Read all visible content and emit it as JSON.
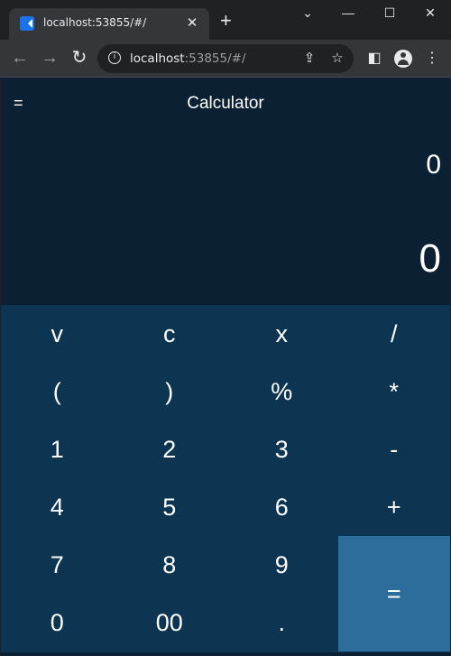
{
  "browser": {
    "tab_title": "localhost:53855/#/",
    "tab_close": "✕",
    "new_tab": "+",
    "window_controls": {
      "minimize": "—",
      "maximize": "☐",
      "close": "✕",
      "menu": "⌄"
    },
    "url_host": "localhost",
    "url_rest": ":53855/#/",
    "nav": {
      "back": "←",
      "forward": "→",
      "reload": "↻"
    }
  },
  "app": {
    "menu_label": "=",
    "title": "Calculator",
    "expression": "0",
    "result": "0",
    "keys": [
      [
        "v",
        "c",
        "x",
        "/"
      ],
      [
        "(",
        ")",
        "%",
        "*"
      ],
      [
        "1",
        "2",
        "3",
        "-"
      ],
      [
        "4",
        "5",
        "6",
        "+"
      ],
      [
        "7",
        "8",
        "9",
        ""
      ],
      [
        "0",
        "00",
        ".",
        ""
      ]
    ],
    "equals_label": "="
  },
  "colors": {
    "app_bg": "#0b2133",
    "keypad_bg": "#0d3450",
    "equals_bg": "#2c6d9c"
  }
}
